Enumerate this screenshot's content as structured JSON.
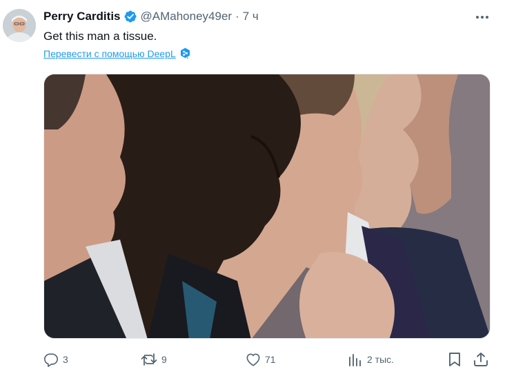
{
  "tweet": {
    "author": {
      "display_name": "Perry Carditis",
      "handle": "@AMahoney49er",
      "verified": true,
      "avatar_icon": "avatar-photo"
    },
    "separator": "·",
    "time": "7 ч",
    "text": "Get this man a tissue.",
    "translate_label": "Перевести с помощью DeepL",
    "translate_icon": "deepl-icon",
    "media_icon": "photo-of-people-in-profile",
    "more_icon": "more-icon"
  },
  "actions": {
    "reply": {
      "icon": "reply-icon",
      "count": "3"
    },
    "retweet": {
      "icon": "retweet-icon",
      "count": "9"
    },
    "like": {
      "icon": "heart-icon",
      "count": "71"
    },
    "views": {
      "icon": "views-icon",
      "count": "2 тыс."
    },
    "bookmark": {
      "icon": "bookmark-icon"
    },
    "share": {
      "icon": "share-icon"
    }
  },
  "colors": {
    "text_primary": "#0f1419",
    "text_secondary": "#536471",
    "accent": "#1d9bf0",
    "verified_badge": "#1d9bf0"
  }
}
